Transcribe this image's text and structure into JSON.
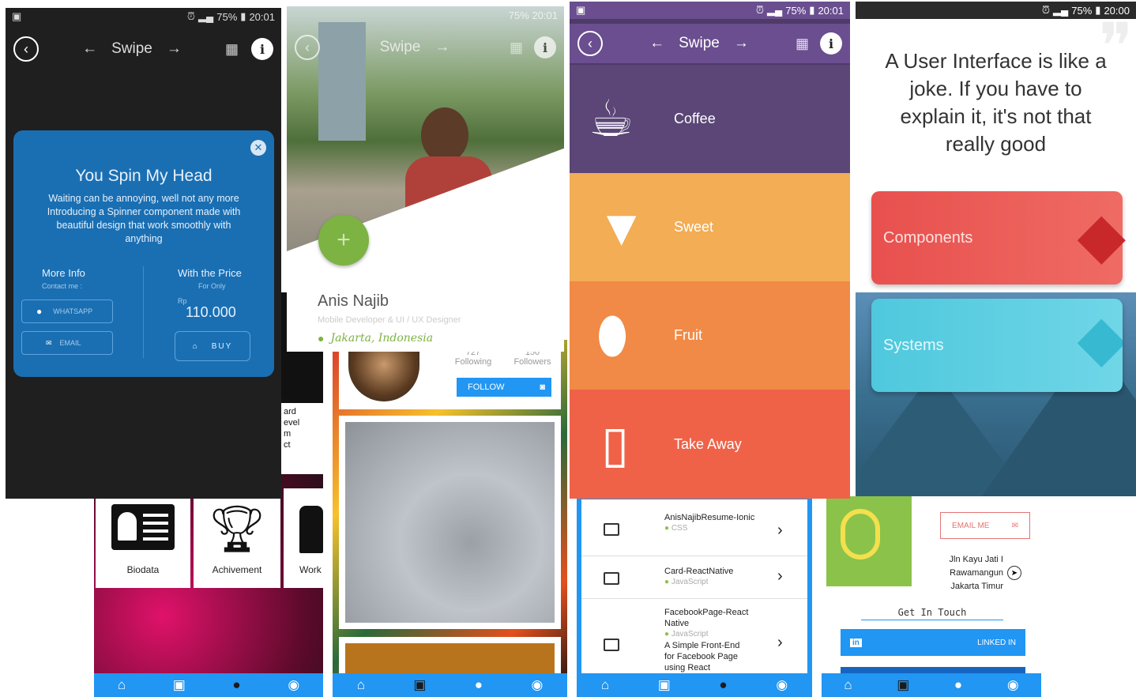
{
  "status": {
    "battery": "75%",
    "time_a": "20:01",
    "time_b": "20:01",
    "time_c": "20:00"
  },
  "toolbar": {
    "swipe_label": "Swipe"
  },
  "dark_card": {
    "title": "You Spin My Head",
    "body": "Waiting can be annoying, well not any more Introducing a Spinner component made with beautiful design that work smoothly with anything",
    "left_heading": "More Info",
    "left_sub": "Contact me :",
    "whatsapp": "WHATSAPP",
    "email": "EMAIL",
    "right_heading": "With the Price",
    "right_sub": "For Only",
    "currency": "Rp",
    "price": "110.000",
    "buy": "BUY"
  },
  "profile": {
    "name": "Anis Najib",
    "role": "Mobile Developer & UI / UX Designer",
    "location": "Jakarta, Indonesia",
    "add": "+"
  },
  "menu": {
    "items": [
      {
        "label": "Coffee",
        "color": "#5b4677"
      },
      {
        "label": "Sweet",
        "color": "#f2ad55"
      },
      {
        "label": "Fruit",
        "color": "#f18a46"
      },
      {
        "label": "Take Away",
        "color": "#ef6248"
      }
    ]
  },
  "quote": {
    "text": "A User Interface is like a joke. If you have to explain it, it's not that really good",
    "components": "Components",
    "systems": "Systems"
  },
  "bio_grid": {
    "side_text": [
      "ard",
      "evel",
      "m",
      "ct"
    ],
    "tiles": [
      "Biodata",
      "Achivement",
      "Work"
    ]
  },
  "social": {
    "following_count": "727",
    "followers_count": "150",
    "following": "Following",
    "followers": "Followers",
    "follow_btn": "FOLLOW"
  },
  "repos": [
    {
      "name": "AnisNajibResume-Ionic",
      "lang": "CSS"
    },
    {
      "name": "Card-ReactNative",
      "lang": "JavaScript"
    },
    {
      "name": "FacebookPage-ReactNative",
      "lang": "JavaScript",
      "desc": "A Simple Front-End for Facebook Page using React"
    }
  ],
  "contact": {
    "email_btn": "EMAIL ME",
    "address": [
      "Jln Kayu Jati I",
      "Rawamangun",
      "Jakarta Timur"
    ],
    "get_in_touch": "Get In Touch",
    "linkedin": "LINKED IN"
  },
  "colors": {
    "nav_blue": "#2196f3",
    "dark_bg": "#1f1f1f",
    "card_blue": "#1a6fb3",
    "red": "#e8504e",
    "cyan": "#4fc8dd",
    "green": "#7cb342"
  }
}
